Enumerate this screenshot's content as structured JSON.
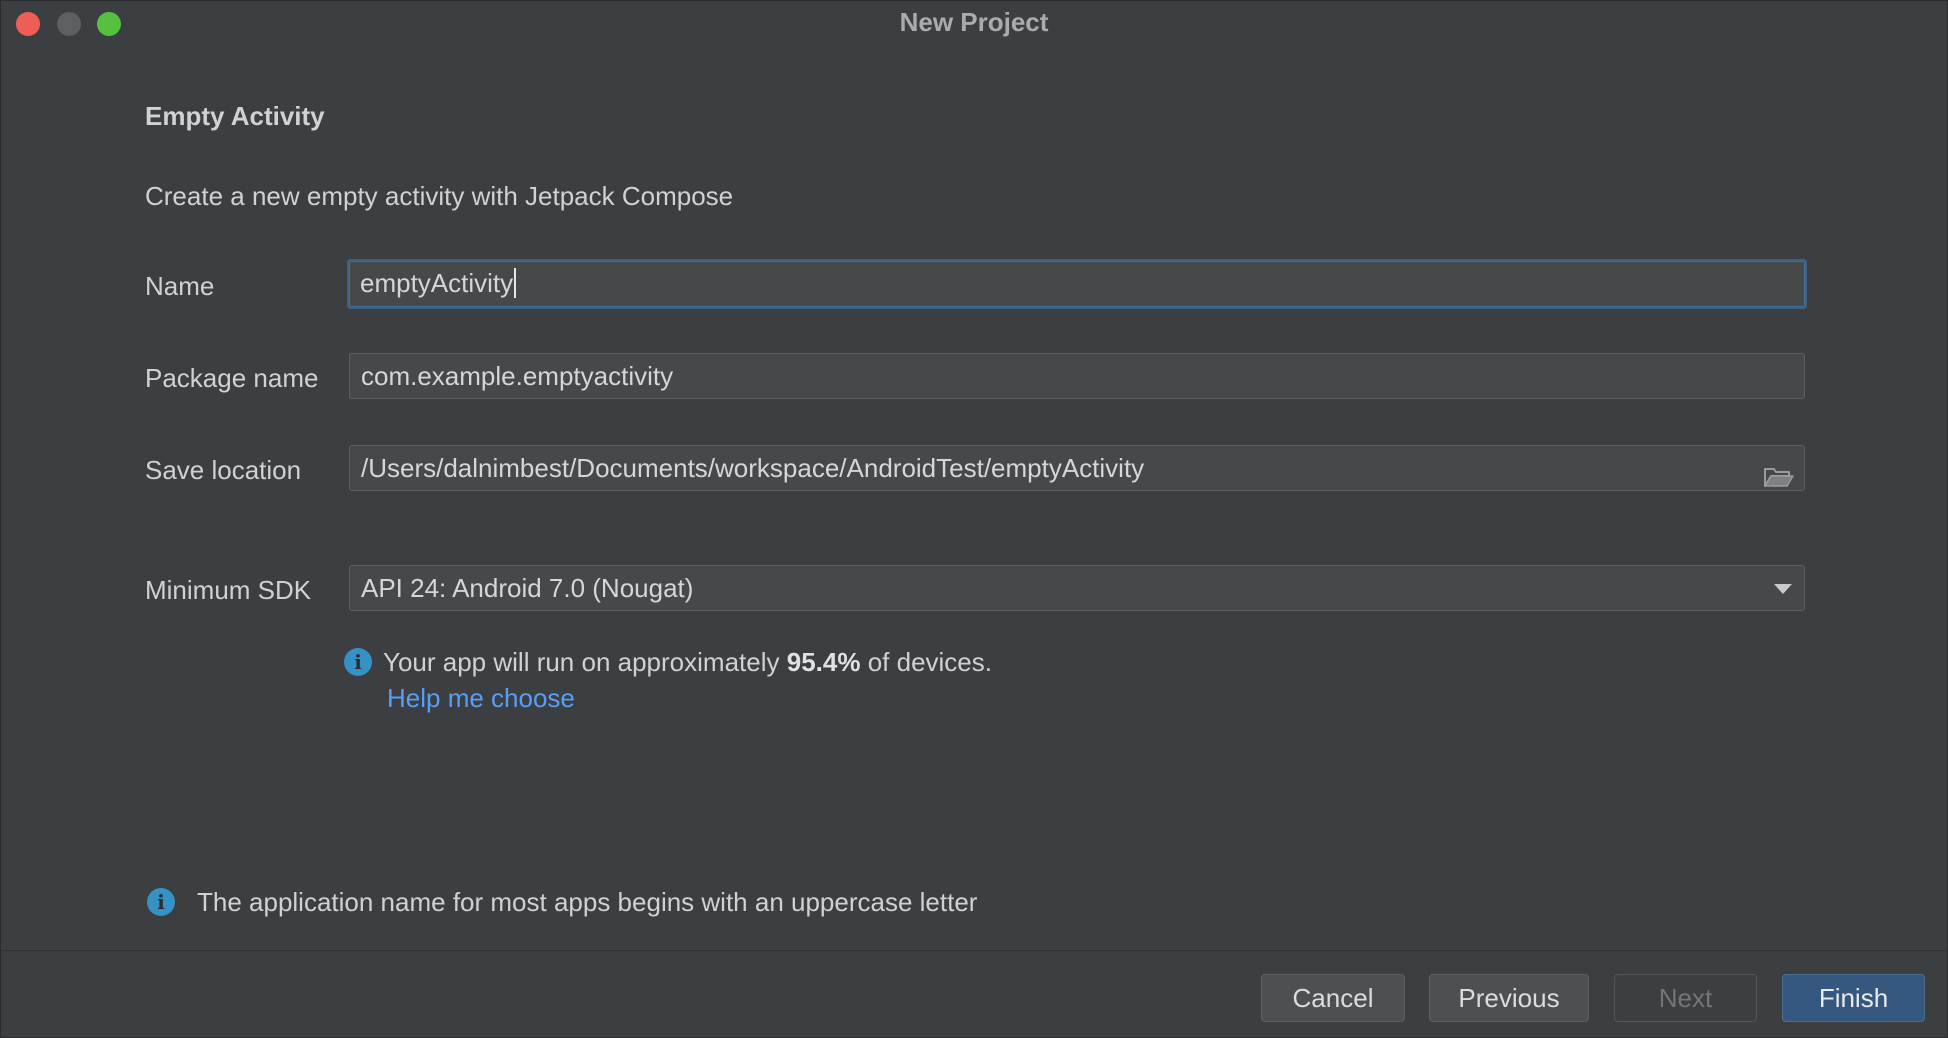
{
  "window": {
    "title": "New Project"
  },
  "page": {
    "heading": "Empty Activity",
    "description": "Create a new empty activity with Jetpack Compose"
  },
  "form": {
    "name": {
      "label": "Name",
      "value": "emptyActivity"
    },
    "package_name": {
      "label": "Package name",
      "value": "com.example.emptyactivity"
    },
    "save_location": {
      "label": "Save location",
      "value": "/Users/dalnimbest/Documents/workspace/AndroidTest/emptyActivity",
      "icon": "folder-icon"
    },
    "minimum_sdk": {
      "label": "Minimum SDK",
      "selected": "API 24: Android 7.0 (Nougat)",
      "icon": "chevron-down-icon"
    }
  },
  "sdk_info": {
    "prefix": "Your app will run on approximately",
    "percent": "95.4%",
    "suffix": "of devices.",
    "help_link": "Help me choose"
  },
  "notice": {
    "text": "The application name for most apps begins with an uppercase letter"
  },
  "buttons": {
    "cancel": "Cancel",
    "previous": "Previous",
    "next": "Next",
    "finish": "Finish"
  },
  "colors": {
    "background": "#3c3f41",
    "accent_primary": "#365880",
    "link": "#589df6",
    "info_icon": "#3592c4",
    "close": "#ee5e56",
    "maximize": "#56c13e"
  }
}
